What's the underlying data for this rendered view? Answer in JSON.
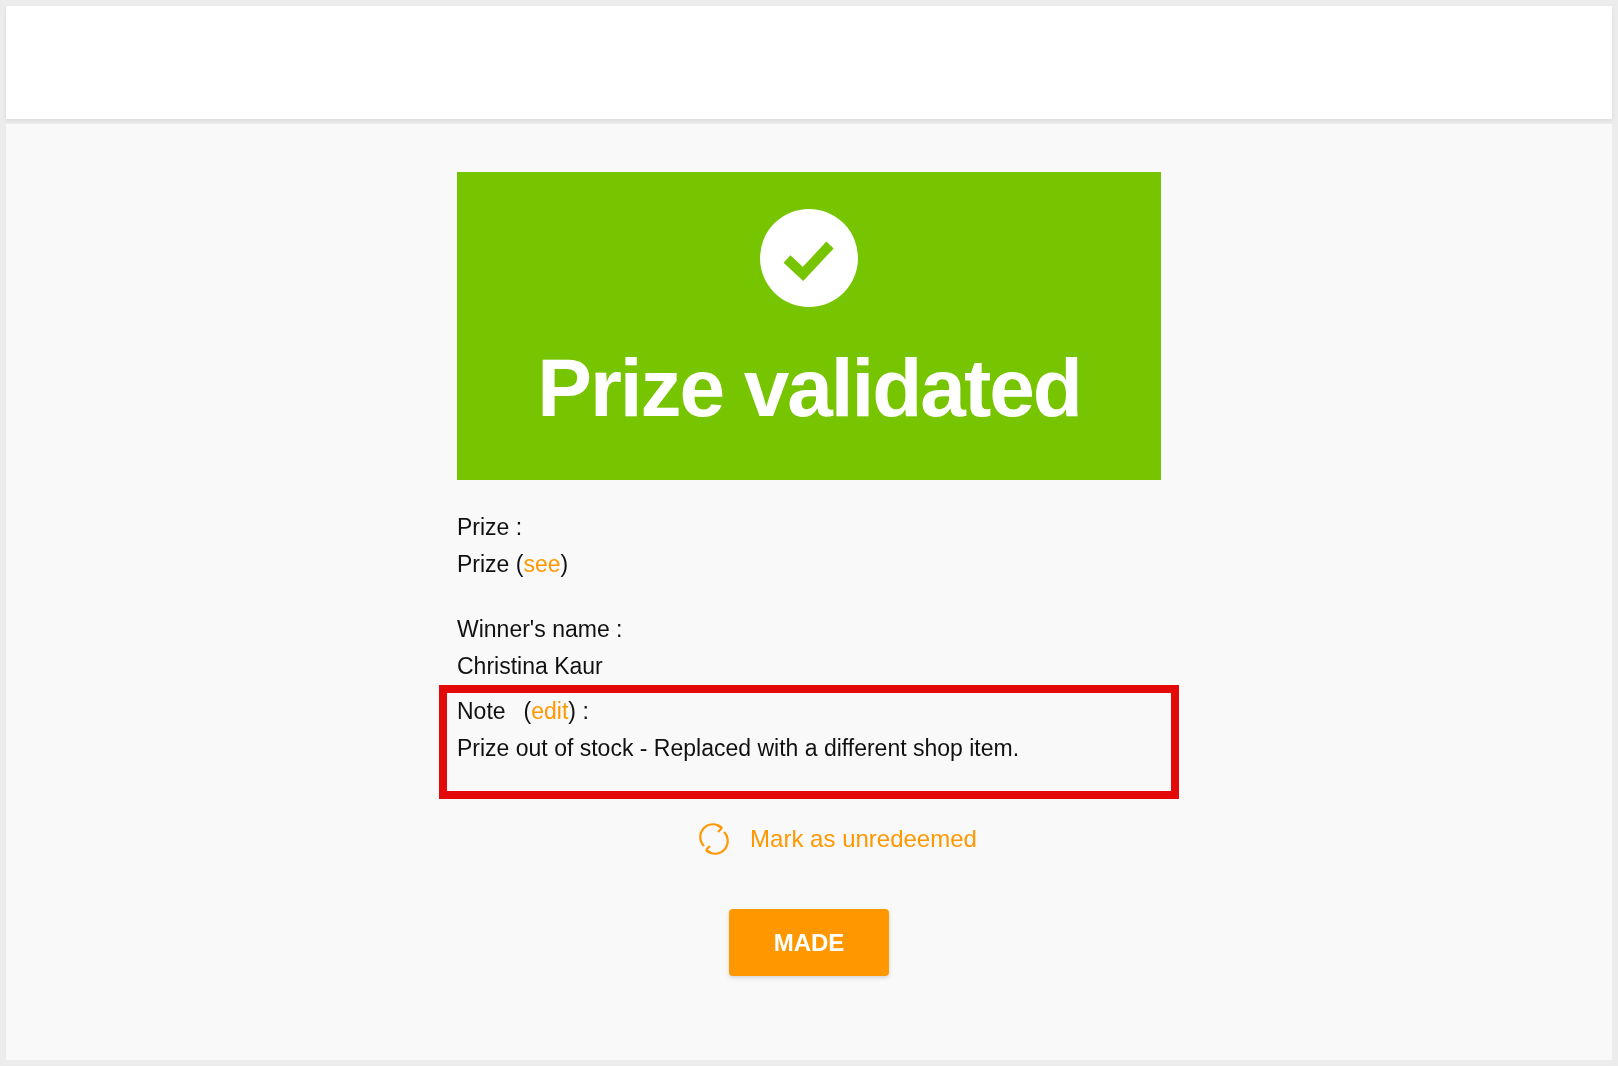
{
  "banner": {
    "title": "Prize validated"
  },
  "prize": {
    "label": "Prize :",
    "value_before": "Prize (",
    "link": "see",
    "value_after": ")"
  },
  "winner": {
    "label": "Winner's name :",
    "value": "Christina Kaur"
  },
  "note": {
    "highlighted": true,
    "label_before": "Note",
    "link_before": "(",
    "link": "edit",
    "label_after": ") :",
    "text": "Prize out of stock - Replaced with a different shop item."
  },
  "unredeem_link": "Mark as unredeemed",
  "button": "MADE"
}
